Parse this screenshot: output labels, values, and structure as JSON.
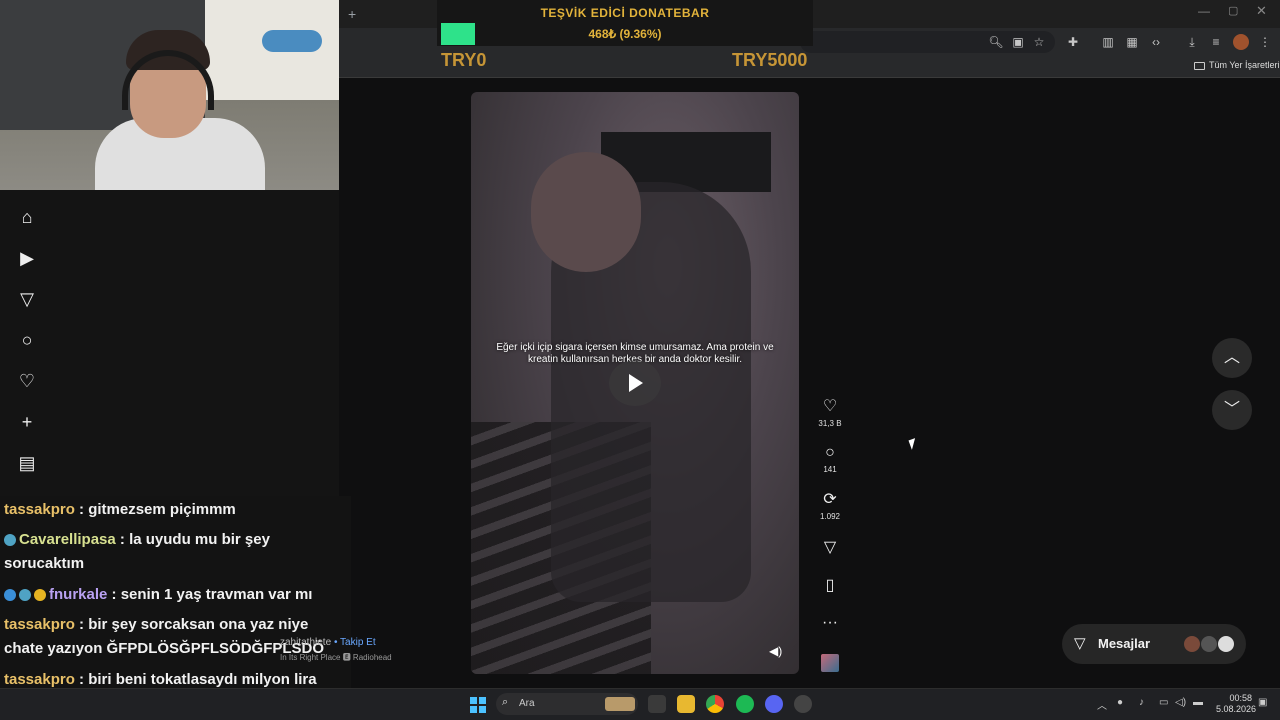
{
  "browser": {
    "new_tab": "+",
    "bookmarks_label": "Tüm Yer İşaretleri",
    "window_controls": {
      "min": "—",
      "max": "▢",
      "close": "✕"
    },
    "toolbar_icons": [
      "zoom-icon",
      "install-icon",
      "star-icon",
      "extensions-icon",
      "delete-icon",
      "apps-icon",
      "devtools-icon",
      "download-icon",
      "media-icon",
      "profile-avatar",
      "menu-icon"
    ]
  },
  "donation": {
    "title": "TEŞVİK EDİCİ DONATEBAR",
    "amount": "468₺ (9.36%)",
    "progress_percent": 9.36,
    "min_label": "TRY0",
    "max_label": "TRY5000",
    "fill_color": "#2ee28a",
    "text_color": "#e2b33b"
  },
  "nav": {
    "items": [
      "home-icon",
      "reels-icon",
      "messages-icon",
      "search-icon",
      "notifications-icon",
      "create-icon",
      "dashboard-icon"
    ]
  },
  "chat": [
    {
      "user": "tassakpro",
      "text": ": gitmezsem piçimmm"
    },
    {
      "user": "Cavarellipasa",
      "text": ": la uyudu mu bir şey sorucaktım"
    },
    {
      "user": "fnurkale",
      "text": ": senin 1 yaş travman var mı"
    },
    {
      "user": "tassakpro",
      "text": ": bir şey sorcaksan ona yaz niye chate yazıyon ĞFPDLÖSĞPFLSÖDĞFPLSDÖ"
    },
    {
      "user": "tassakpro",
      "text": ": biri beni tokatlasaydı milyon lira için olurdu muhtemelen"
    }
  ],
  "post": {
    "caption": "Eğer içki içip sigara içersen kimse umursamaz. Ama protein ve kreatin kullanırsan herkes bir anda doktor kesilir.",
    "author": "zahitathlete",
    "follow": "• Takip Et",
    "song": "In Its Right Place 🅴 Radiohead"
  },
  "actions": {
    "likes": "31,3 B",
    "comments": "141",
    "reposts": "1.092"
  },
  "messages": {
    "label": "Mesajlar"
  },
  "taskbar": {
    "search_label": "Ara",
    "time": "00:58",
    "date": "5.08.2026"
  }
}
